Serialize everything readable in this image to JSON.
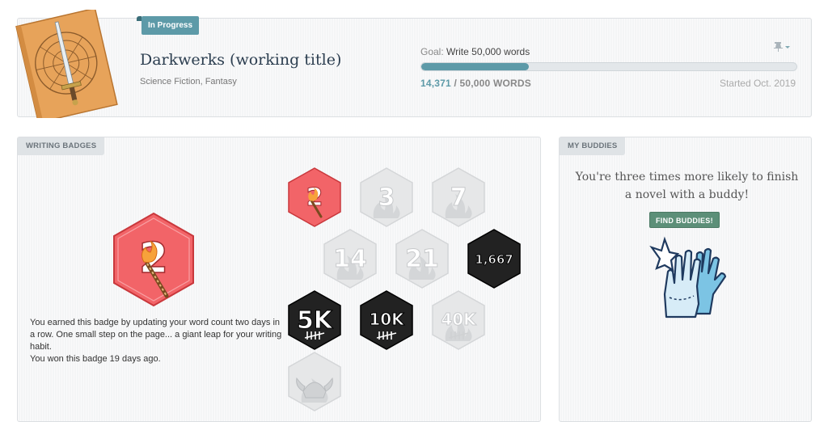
{
  "project": {
    "status": "In Progress",
    "title": "Darkwerks (working title)",
    "genres": "Science Fiction, Fantasy",
    "goal_label": "Goal:",
    "goal_text": "Write 50,000 words",
    "current_words": "14,371",
    "goal_words": " / 50,000 WORDS",
    "progress_fraction": 0.287,
    "started": "Started Oct. 2019",
    "cover_icon": "sword-compass-cover",
    "pin_icon": "pin-icon"
  },
  "badges_section": {
    "label": "WRITING BADGES",
    "selected": {
      "text": "2",
      "icon": "matchstick-icon"
    },
    "description_line1": "You earned this badge by updating your word count two days in a row. One small step on the page... a giant leap for your writing habit.",
    "description_line2": "You won this badge 19 days ago.",
    "badges": [
      {
        "text": "2",
        "state": "earned-red"
      },
      {
        "text": "3",
        "state": "locked"
      },
      {
        "text": "7",
        "state": "locked"
      },
      {
        "text": "14",
        "state": "locked"
      },
      {
        "text": "21",
        "state": "locked"
      },
      {
        "text": "1,667",
        "state": "earned-dark"
      },
      {
        "text": "5K",
        "state": "earned-dark"
      },
      {
        "text": "10K",
        "state": "earned-dark"
      },
      {
        "text": "40K",
        "state": "locked"
      },
      {
        "text": "",
        "state": "locked-viking"
      }
    ]
  },
  "buddies_section": {
    "label": "MY BUDDIES",
    "pitch": "You're three times more likely to finish a novel with a buddy!",
    "button": "FIND BUDDIES!",
    "illustration": "high-five-icon"
  },
  "colors": {
    "accent_teal": "#5d9aa8",
    "badge_red": "#f26468",
    "badge_dark": "#222222",
    "badge_locked": "#e6e7e8",
    "buddy_button": "#5c8f78"
  }
}
